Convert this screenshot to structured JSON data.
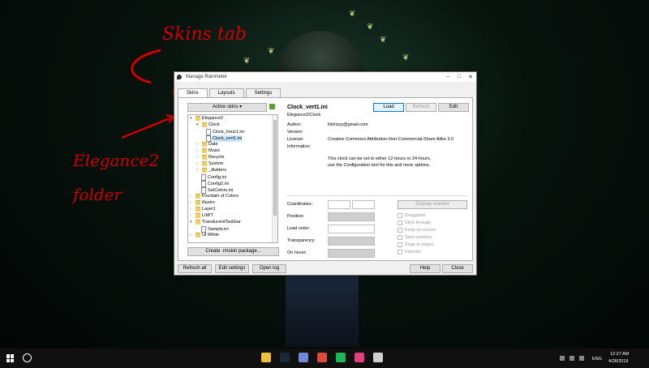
{
  "annotations": {
    "skins_tab": "Skins tab",
    "elegance_folder_line1": "Elegance2",
    "elegance_folder_line2": "folder"
  },
  "window": {
    "title": "Manage Rainmeter",
    "controls": {
      "minimize": "–",
      "maximize": "□",
      "close": "✕"
    }
  },
  "tabs": [
    {
      "label": "Skins"
    },
    {
      "label": "Layouts"
    },
    {
      "label": "Settings"
    }
  ],
  "left": {
    "active_skins": "Active skins ▾",
    "tree": [
      {
        "label": "Elegance2",
        "icon": "folder-icon",
        "exp": "▾"
      },
      {
        "label": "Clock",
        "icon": "folder-icon",
        "exp": "▾"
      },
      {
        "label": "Clock_horiz1.ini",
        "icon": "file-icon",
        "exp": ""
      },
      {
        "label": "Clock_vert1.ini",
        "icon": "file-icon",
        "exp": ""
      },
      {
        "label": "Date",
        "icon": "folder-icon",
        "exp": "›"
      },
      {
        "label": "Music",
        "icon": "folder-icon",
        "exp": "›"
      },
      {
        "label": "Recycle",
        "icon": "folder-icon",
        "exp": "›"
      },
      {
        "label": "System",
        "icon": "folder-icon",
        "exp": "›"
      },
      {
        "label": "_dividers",
        "icon": "folder-icon",
        "exp": "›"
      },
      {
        "label": "Config.ini",
        "icon": "file-icon",
        "exp": ""
      },
      {
        "label": "Config2.ini",
        "icon": "file-icon",
        "exp": ""
      },
      {
        "label": "SetColors.ini",
        "icon": "file-icon",
        "exp": ""
      },
      {
        "label": "Fountain of Colors",
        "icon": "folder-icon",
        "exp": "›"
      },
      {
        "label": "illustro",
        "icon": "folder-icon",
        "exp": "›"
      },
      {
        "label": "Layer1",
        "icon": "folder-icon",
        "exp": "›"
      },
      {
        "label": "LIM!T",
        "icon": "folder-icon",
        "exp": "›"
      },
      {
        "label": "TranslucentTaskbar",
        "icon": "folder-icon",
        "exp": "▾"
      },
      {
        "label": "Sample.ini",
        "icon": "file-icon",
        "exp": ""
      },
      {
        "label": "UI White",
        "icon": "folder-icon",
        "exp": "›"
      }
    ],
    "create_package": "Create .rmskin package..."
  },
  "right": {
    "skin_name": "Clock_vert1.ini",
    "skin_path": "Elegance2\\Clock",
    "buttons": {
      "load": "Load",
      "refresh": "Refresh",
      "edit": "Edit"
    },
    "meta": [
      {
        "label": "Author:",
        "value": "lilshizzy@gmail.com"
      },
      {
        "label": "Version:",
        "value": ""
      },
      {
        "label": "License:",
        "value": "Creative Commons Attribution-Non-Commercial-Share Alike 3.0"
      },
      {
        "label": "Information:",
        "value": ""
      }
    ],
    "info_line1": "This clock can be set to either 12-hours or 24-hours,",
    "info_line2": "use the Configuration tool for this and more options.",
    "settings_labels": [
      "Coordinates:",
      "Position:",
      "Load order:",
      "Transparency:",
      "On hover:"
    ],
    "display_monitor": "Display monitor",
    "checkboxes": [
      "Draggable",
      "Click through",
      "Keep on screen",
      "Save position",
      "Snap to edges",
      "Favorite"
    ]
  },
  "bottom": {
    "refresh_all": "Refresh all",
    "edit_settings": "Edit settings",
    "open_log": "Open log",
    "help": "Help",
    "close": "Close"
  },
  "taskbar": {
    "time": "12:27 AM",
    "date": "4/28/2019",
    "lang": "ENG",
    "apps": [
      {
        "name": "file-explorer-icon",
        "color": "#f0c040"
      },
      {
        "name": "steam-icon",
        "color": "#1b2838"
      },
      {
        "name": "discord-icon",
        "color": "#7289da"
      },
      {
        "name": "chrome-icon",
        "color": "#dd4b39"
      },
      {
        "name": "spotify-icon",
        "color": "#1db954"
      },
      {
        "name": "app-icon",
        "color": "#e04080"
      },
      {
        "name": "rainmeter-icon",
        "color": "#cfcfcf"
      }
    ]
  }
}
